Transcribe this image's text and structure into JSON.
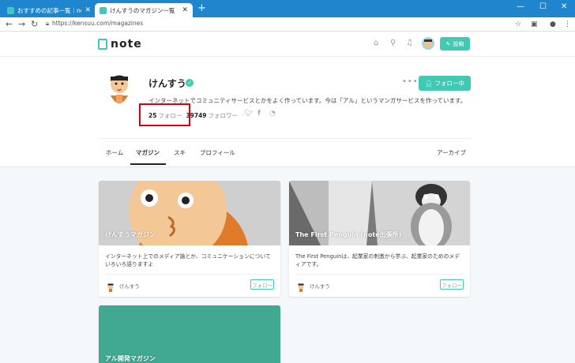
{
  "browser": {
    "tabs": [
      {
        "title": "おすすめの記事一覧｜note ――つ",
        "active": false
      },
      {
        "title": "けんすうのマガジン一覧",
        "active": true
      }
    ],
    "new_tab": "+",
    "window_controls": {
      "minimize": "—",
      "maximize": "☐",
      "close": "✕"
    },
    "url": "https://kensuu.com/magazines"
  },
  "site": {
    "logo": "note",
    "post_button": "投稿",
    "accent": "#41c9b4"
  },
  "profile": {
    "name": "けんすう",
    "verified_mark": "✓",
    "more": "•••",
    "following_button": "フォロー中",
    "bio": "インターネットでコミュニティサービスとかをよく作っています。今は「アル」というマンガサービスを作っています。",
    "follow_count": "25",
    "follow_label": "フォロー",
    "follower_count": "39749",
    "follower_label": "フォロワー",
    "dot": "·"
  },
  "nav": {
    "home": "ホーム",
    "magazine": "マガジン",
    "like": "スキ",
    "profile": "プロフィール",
    "archive": "アーカイブ"
  },
  "cards": [
    {
      "title": "けんすうマガジン",
      "description": "インターネット上でのメディア論とか、コミュニケーションについていろいろ語りますよ",
      "author": "けんすう",
      "follow": "フォロー"
    },
    {
      "title": "The First Penguin (note出張所)",
      "description": "The First Penguinは、起業家の刺激から学ぶ、起業家のためのメディアです。",
      "author": "けんすう",
      "follow": "フォロー"
    },
    {
      "title": "アル開発マガジン"
    }
  ]
}
